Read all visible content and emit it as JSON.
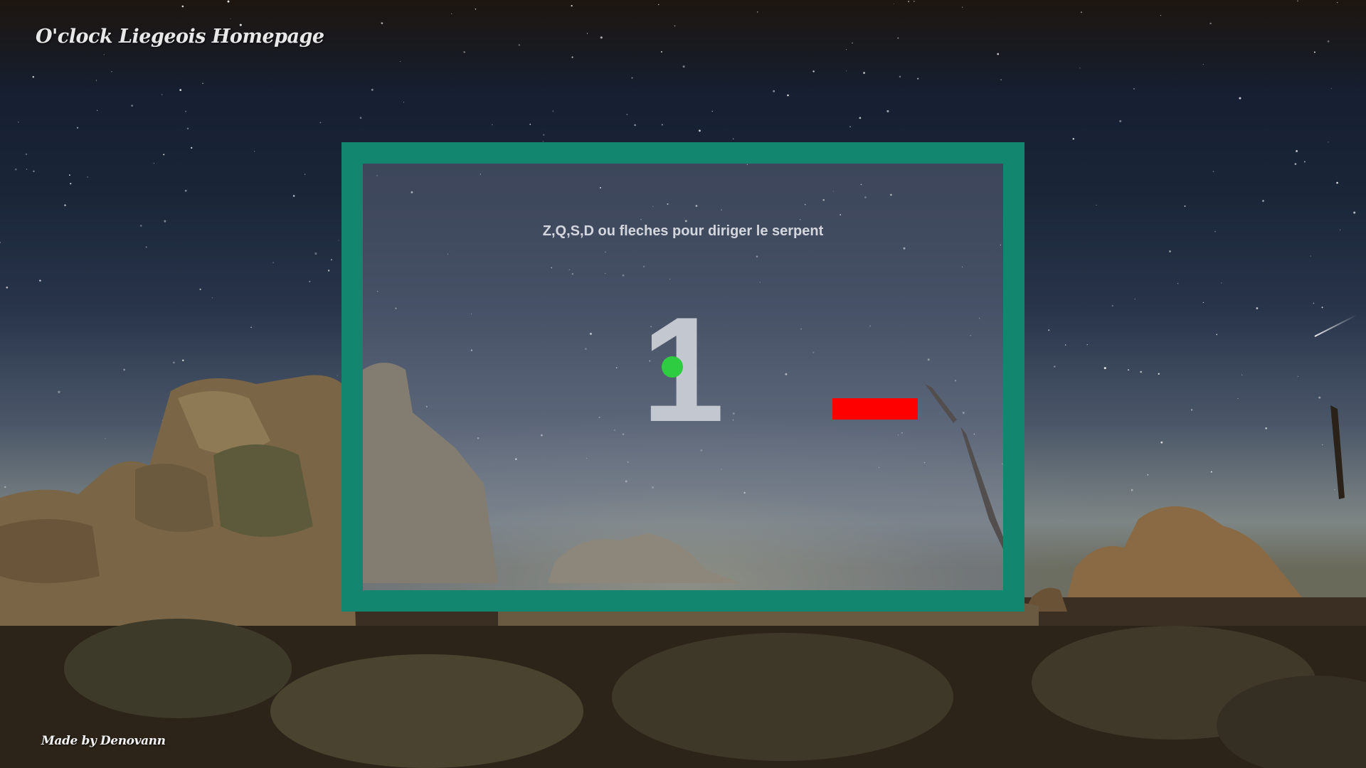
{
  "header": {
    "title": "O'clock Liegeois Homepage"
  },
  "footer": {
    "credit": "Made by Denovann"
  },
  "game": {
    "instructions": "Z,Q,S,D ou fleches pour diriger le serpent",
    "countdown": "1",
    "food_color": "#2ecc40",
    "snake_color": "#ff0000",
    "frame_color": "#138670"
  }
}
